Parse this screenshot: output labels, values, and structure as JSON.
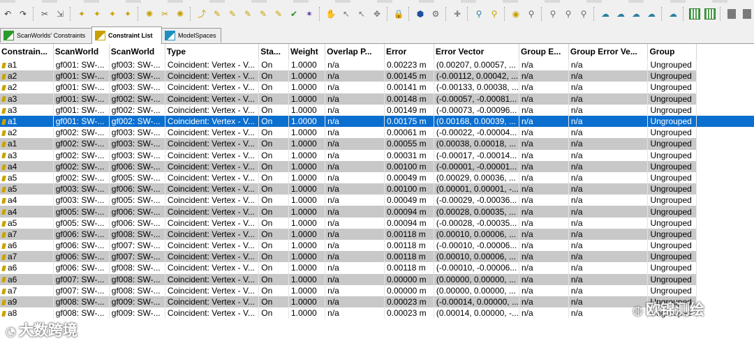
{
  "toolbar": {
    "buttons": [
      {
        "name": "undo-icon",
        "glyph": "↶",
        "color": "#3a3a3a"
      },
      {
        "name": "redo-icon",
        "glyph": "↷",
        "color": "#3a3a3a"
      },
      {
        "sep": true
      },
      {
        "name": "scissor-tool-icon",
        "glyph": "✂",
        "color": "#555555"
      },
      {
        "name": "pick-constraint-icon",
        "glyph": "⇲",
        "color": "#666666"
      },
      {
        "sep": true
      },
      {
        "name": "constraint-add-icon",
        "glyph": "✦",
        "color": "#c8a000"
      },
      {
        "name": "constraint-add-vertex-icon",
        "glyph": "✦",
        "color": "#c8a000"
      },
      {
        "name": "constraint-add-cloud-icon",
        "glyph": "✦",
        "color": "#c8a000"
      },
      {
        "name": "constraint-add-all-icon",
        "glyph": "✦",
        "color": "#c8a000"
      },
      {
        "sep": true
      },
      {
        "name": "constraint-toggle-icon",
        "glyph": "✺",
        "color": "#c8a000"
      },
      {
        "name": "constraint-disable-icon",
        "glyph": "✂",
        "color": "#c8a000"
      },
      {
        "name": "constraint-enable-icon",
        "glyph": "✺",
        "color": "#c8a000"
      },
      {
        "sep": true
      },
      {
        "name": "link-icon",
        "glyph": "⤴",
        "color": "#c8a000"
      },
      {
        "name": "link-vertex-icon",
        "glyph": "✎",
        "color": "#c8a000"
      },
      {
        "name": "link-cloud-icon",
        "glyph": "✎",
        "color": "#c8a000"
      },
      {
        "name": "link-target-icon",
        "glyph": "✎",
        "color": "#c8a000"
      },
      {
        "name": "link-group-icon",
        "glyph": "✎",
        "color": "#c8a000"
      },
      {
        "name": "link-update-icon",
        "glyph": "✎",
        "color": "#c8a000"
      },
      {
        "name": "check-icon",
        "glyph": "✔",
        "color": "#2a8f2a"
      },
      {
        "name": "color-constraint-icon",
        "glyph": "✶",
        "color": "#5a2fa0"
      },
      {
        "sep": true
      },
      {
        "name": "hand-icon",
        "glyph": "✋",
        "color": "#777777"
      },
      {
        "name": "cursor-icon",
        "glyph": "↖",
        "color": "#777777"
      },
      {
        "name": "select-icon",
        "glyph": "↖",
        "color": "#777777"
      },
      {
        "name": "crosshair-icon",
        "glyph": "✥",
        "color": "#777777"
      },
      {
        "sep": true
      },
      {
        "name": "lock-icon",
        "glyph": "🔒",
        "color": "#c02020"
      },
      {
        "sep": true
      },
      {
        "name": "register-icon",
        "glyph": "⬢",
        "color": "#1f4fa0"
      },
      {
        "name": "optimize-icon",
        "glyph": "⚙",
        "color": "#666666"
      },
      {
        "sep": true
      },
      {
        "name": "add-icon",
        "glyph": "✚",
        "color": "#888888"
      },
      {
        "sep": true
      },
      {
        "name": "vertex-link-icon",
        "glyph": "⚲",
        "color": "#2a7fa0"
      },
      {
        "name": "vertex-unlink-icon",
        "glyph": "⚲",
        "color": "#c8a000"
      },
      {
        "sep": true
      },
      {
        "name": "scanworld-icon",
        "glyph": "◉",
        "color": "#c8a000"
      },
      {
        "name": "scanworld-merge-icon",
        "glyph": "⚲",
        "color": "#666666"
      },
      {
        "sep": true
      },
      {
        "name": "modelspace-icon",
        "glyph": "⚲",
        "color": "#666666"
      },
      {
        "name": "modelspace-add-icon",
        "glyph": "⚲",
        "color": "#666666"
      },
      {
        "name": "modelspace-export-icon",
        "glyph": "⚲",
        "color": "#666666"
      },
      {
        "sep": true
      },
      {
        "name": "cloud-icon",
        "glyph": "☁",
        "color": "#2a7fa0"
      },
      {
        "name": "cloud-link-icon",
        "glyph": "☁",
        "color": "#2a7fa0"
      },
      {
        "name": "cloud-target-icon",
        "glyph": "☁",
        "color": "#2a7fa0"
      },
      {
        "name": "cloud-send-icon",
        "glyph": "☁",
        "color": "#2a7fa0"
      },
      {
        "sep": true
      },
      {
        "name": "cloud-settings-icon",
        "glyph": "☁",
        "color": "#2a7fa0"
      },
      {
        "sep": true
      },
      {
        "name": "grid-view-icon",
        "grid": true
      },
      {
        "name": "grid-select-icon",
        "grid": true
      },
      {
        "sep": true
      },
      {
        "name": "panel-left-icon",
        "square": true
      },
      {
        "name": "panel-right-icon",
        "square": true
      },
      {
        "name": "panel-bottom-icon",
        "square": true
      }
    ]
  },
  "tabs": [
    {
      "label": "ScanWorlds' Constraints",
      "icon": "scanworld-constraints-tab-icon",
      "color": "#2a9a2a",
      "active": false
    },
    {
      "label": "Constraint List",
      "icon": "constraint-list-tab-icon",
      "color": "#c8a000",
      "active": true
    },
    {
      "label": "ModelSpaces",
      "icon": "modelspaces-tab-icon",
      "color": "#1f8fc0",
      "active": false
    }
  ],
  "columns": [
    "Constrain...",
    "ScanWorld",
    "ScanWorld",
    "Type",
    "Sta...",
    "Weight",
    "Overlap P...",
    "Error",
    "Error Vector",
    "Group E...",
    "Group Error Ve...",
    "Group"
  ],
  "rows": [
    [
      "a1",
      "gf001: SW-...",
      "gf003: SW-...",
      "Coincident: Vertex - V...",
      "On",
      "1.0000",
      "n/a",
      "0.00223 m",
      "(0.00207, 0.00057, ...",
      "n/a",
      "n/a",
      "Ungrouped"
    ],
    [
      "a2",
      "gf001: SW-...",
      "gf003: SW-...",
      "Coincident: Vertex - V...",
      "On",
      "1.0000",
      "n/a",
      "0.00145 m",
      "(-0.00112, 0.00042, ...",
      "n/a",
      "n/a",
      "Ungrouped"
    ],
    [
      "a2",
      "gf001: SW-...",
      "gf003: SW-...",
      "Coincident: Vertex - V...",
      "On",
      "1.0000",
      "n/a",
      "0.00141 m",
      "(-0.00133, 0.00038, ...",
      "n/a",
      "n/a",
      "Ungrouped"
    ],
    [
      "a3",
      "gf001: SW-...",
      "gf002: SW-...",
      "Coincident: Vertex - V...",
      "On",
      "1.0000",
      "n/a",
      "0.00148 m",
      "(-0.00057, -0.00081...",
      "n/a",
      "n/a",
      "Ungrouped"
    ],
    [
      "a3",
      "gf001: SW-...",
      "gf002: SW-...",
      "Coincident: Vertex - V...",
      "On",
      "1.0000",
      "n/a",
      "0.00149 m",
      "(-0.00073, -0.00096...",
      "n/a",
      "n/a",
      "Ungrouped"
    ],
    [
      "a1",
      "gf001: SW-...",
      "gf002: SW-...",
      "Coincident: Vertex - V...",
      "On",
      "1.0000",
      "n/a",
      "0.00175 m",
      "(0.00168, 0.00039, ...",
      "n/a",
      "n/a",
      "Ungrouped"
    ],
    [
      "a2",
      "gf002: SW-...",
      "gf003: SW-...",
      "Coincident: Vertex - V...",
      "On",
      "1.0000",
      "n/a",
      "0.00061 m",
      "(-0.00022, -0.00004...",
      "n/a",
      "n/a",
      "Ungrouped"
    ],
    [
      "a1",
      "gf002: SW-...",
      "gf003: SW-...",
      "Coincident: Vertex - V...",
      "On",
      "1.0000",
      "n/a",
      "0.00055 m",
      "(0.00038, 0.00018, ...",
      "n/a",
      "n/a",
      "Ungrouped"
    ],
    [
      "a3",
      "gf002: SW-...",
      "gf003: SW-...",
      "Coincident: Vertex - V...",
      "On",
      "1.0000",
      "n/a",
      "0.00031 m",
      "(-0.00017, -0.00014...",
      "n/a",
      "n/a",
      "Ungrouped"
    ],
    [
      "a4",
      "gf002: SW-...",
      "gf006: SW-...",
      "Coincident: Vertex - V...",
      "On",
      "1.0000",
      "n/a",
      "0.00100 m",
      "(-0.00001, -0.00001...",
      "n/a",
      "n/a",
      "Ungrouped"
    ],
    [
      "a5",
      "gf002: SW-...",
      "gf005: SW-...",
      "Coincident: Vertex - V...",
      "On",
      "1.0000",
      "n/a",
      "0.00049 m",
      "(0.00029, 0.00036, ...",
      "n/a",
      "n/a",
      "Ungrouped"
    ],
    [
      "a5",
      "gf003: SW-...",
      "gf006: SW-...",
      "Coincident: Vertex - V...",
      "On",
      "1.0000",
      "n/a",
      "0.00100 m",
      "(0.00001, 0.00001, -...",
      "n/a",
      "n/a",
      "Ungrouped"
    ],
    [
      "a4",
      "gf003: SW-...",
      "gf005: SW-...",
      "Coincident: Vertex - V...",
      "On",
      "1.0000",
      "n/a",
      "0.00049 m",
      "(-0.00029, -0.00036...",
      "n/a",
      "n/a",
      "Ungrouped"
    ],
    [
      "a4",
      "gf005: SW-...",
      "gf006: SW-...",
      "Coincident: Vertex - V...",
      "On",
      "1.0000",
      "n/a",
      "0.00094 m",
      "(0.00028, 0.00035, ...",
      "n/a",
      "n/a",
      "Ungrouped"
    ],
    [
      "a5",
      "gf005: SW-...",
      "gf006: SW-...",
      "Coincident: Vertex - V...",
      "On",
      "1.0000",
      "n/a",
      "0.00094 m",
      "(-0.00028, -0.00035...",
      "n/a",
      "n/a",
      "Ungrouped"
    ],
    [
      "a7",
      "gf006: SW-...",
      "gf008: SW-...",
      "Coincident: Vertex - V...",
      "On",
      "1.0000",
      "n/a",
      "0.00118 m",
      "(0.00010, 0.00006, ...",
      "n/a",
      "n/a",
      "Ungrouped"
    ],
    [
      "a6",
      "gf006: SW-...",
      "gf007: SW-...",
      "Coincident: Vertex - V...",
      "On",
      "1.0000",
      "n/a",
      "0.00118 m",
      "(-0.00010, -0.00006...",
      "n/a",
      "n/a",
      "Ungrouped"
    ],
    [
      "a7",
      "gf006: SW-...",
      "gf007: SW-...",
      "Coincident: Vertex - V...",
      "On",
      "1.0000",
      "n/a",
      "0.00118 m",
      "(0.00010, 0.00006, ...",
      "n/a",
      "n/a",
      "Ungrouped"
    ],
    [
      "a6",
      "gf006: SW-...",
      "gf008: SW-...",
      "Coincident: Vertex - V...",
      "On",
      "1.0000",
      "n/a",
      "0.00118 m",
      "(-0.00010, -0.00006...",
      "n/a",
      "n/a",
      "Ungrouped"
    ],
    [
      "a6",
      "gf007: SW-...",
      "gf008: SW-...",
      "Coincident: Vertex - V...",
      "On",
      "1.0000",
      "n/a",
      "0.00000 m",
      "(0.00000, 0.00000, ...",
      "n/a",
      "n/a",
      "Ungrouped"
    ],
    [
      "a7",
      "gf007: SW-...",
      "gf008: SW-...",
      "Coincident: Vertex - V...",
      "On",
      "1.0000",
      "n/a",
      "0.00000 m",
      "(0.00000, 0.00000, ...",
      "n/a",
      "n/a",
      "Ungrouped"
    ],
    [
      "a9",
      "gf008: SW-...",
      "gf009: SW-...",
      "Coincident: Vertex - V...",
      "On",
      "1.0000",
      "n/a",
      "0.00023 m",
      "(-0.00014, 0.00000, ...",
      "n/a",
      "n/a",
      "Ungrouped"
    ],
    [
      "a8",
      "gf008: SW-...",
      "gf009: SW-...",
      "Coincident: Vertex - V...",
      "On",
      "1.0000",
      "n/a",
      "0.00023 m",
      "(0.00014, 0.00000, -...",
      "n/a",
      "n/a",
      "Ungrouped"
    ]
  ],
  "selected_row": 5,
  "colors": {
    "selection": "#0b6fcf",
    "stripe": "#c8c8c8",
    "constraint_icon": "#c9a400"
  },
  "watermarks": {
    "left": "大数跨境",
    "right": "欧锦测绘"
  }
}
